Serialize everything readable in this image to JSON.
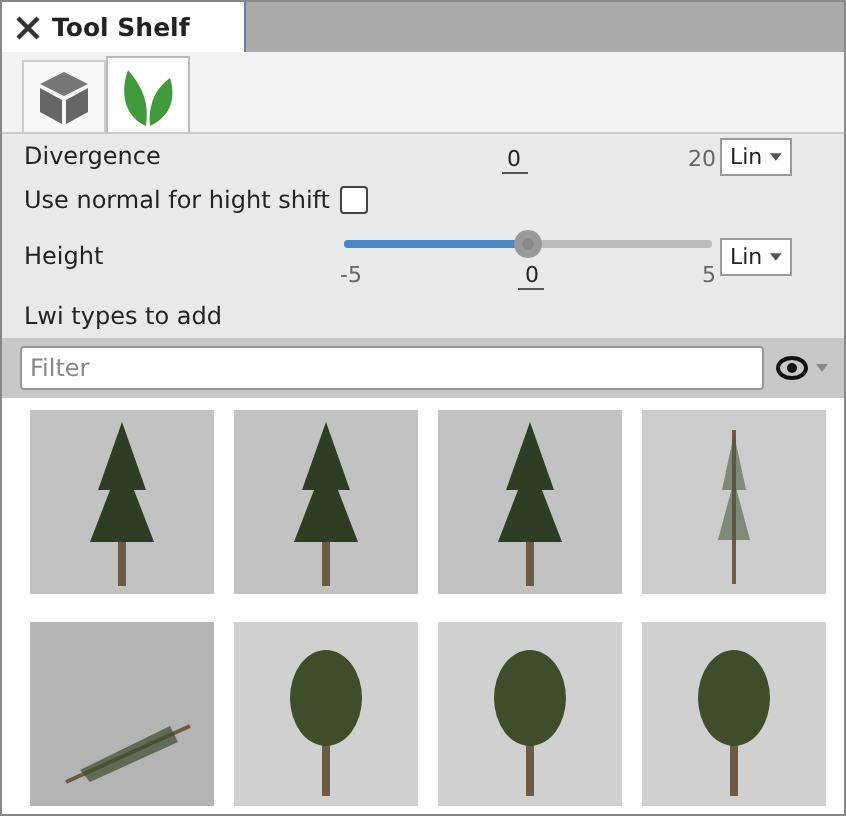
{
  "window": {
    "title": "Tool Shelf"
  },
  "shelf_tabs": [
    {
      "kind": "cube",
      "selected": false
    },
    {
      "kind": "leaves",
      "selected": true
    }
  ],
  "parameters": [
    {
      "kind": "slider",
      "label": "Divergence",
      "value": "0",
      "max": "20",
      "mode": "Lin"
    },
    {
      "kind": "checkbox",
      "label": "Use normal for hight shift",
      "checked": false
    },
    {
      "kind": "slider",
      "label": "Height",
      "min": "-5",
      "value": "0",
      "max": "5",
      "mode": "Lin",
      "level": 0.5
    }
  ],
  "types_section": {
    "title": "Lwi types to add",
    "filter": {
      "placeholder": "Filter"
    }
  },
  "thumbnails": [
    {
      "kind": "upright"
    },
    {
      "kind": "upright"
    },
    {
      "kind": "upright"
    },
    {
      "kind": "sparse"
    },
    {
      "kind": "fallen"
    },
    {
      "kind": "round"
    },
    {
      "kind": "round"
    },
    {
      "kind": "round"
    }
  ]
}
